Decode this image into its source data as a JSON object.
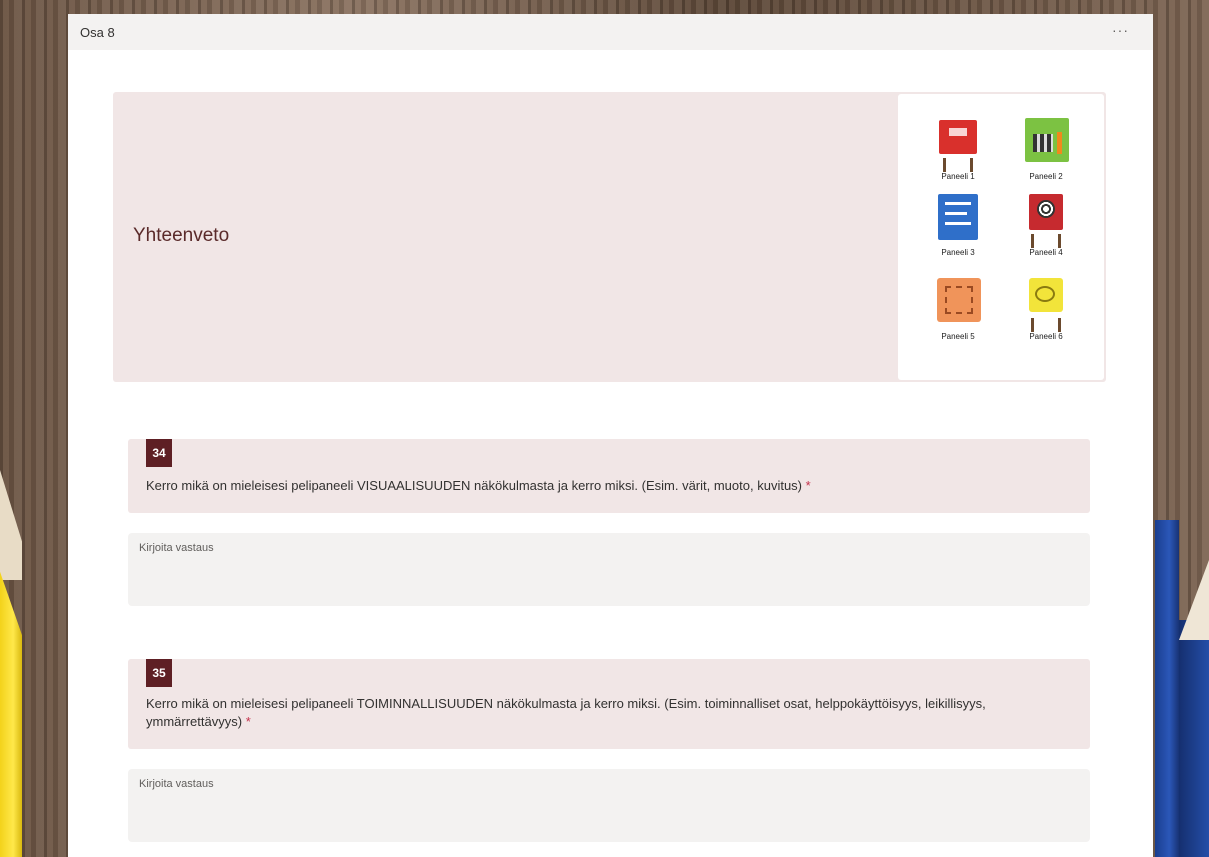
{
  "form": {
    "section_label": "Osa 8",
    "more_label": "···"
  },
  "header": {
    "title": "Yhteenveto",
    "panels": [
      {
        "label": "Paneeli 1",
        "color": "#d9302c"
      },
      {
        "label": "Paneeli 2",
        "color": "#7cc242"
      },
      {
        "label": "Paneeli 3",
        "color": "#2f6fc9"
      },
      {
        "label": "Paneeli 4",
        "color": "#c62a2f"
      },
      {
        "label": "Paneeli 5",
        "color": "#f0945a"
      },
      {
        "label": "Paneeli 6",
        "color": "#f2e43a"
      }
    ]
  },
  "questions": [
    {
      "number": "34",
      "text": "Kerro mikä on mieleisesi pelipaneeli VISUAALISUUDEN näkökulmasta ja kerro miksi. (Esim. värit, muoto, kuvitus)",
      "required_mark": "*",
      "placeholder": "Kirjoita vastaus"
    },
    {
      "number": "35",
      "text": "Kerro mikä on mieleisesi pelipaneeli TOIMINNALLISUUDEN näkökulmasta ja kerro miksi. (Esim. toiminnalliset osat, helppokäyttöisyys, leikillisyys, ymmärrettävyys)",
      "required_mark": "*",
      "placeholder": "Kirjoita vastaus"
    }
  ],
  "colors": {
    "accent": "#5e1f24",
    "card_bg": "#f1e6e6",
    "required": "#c4314b"
  }
}
